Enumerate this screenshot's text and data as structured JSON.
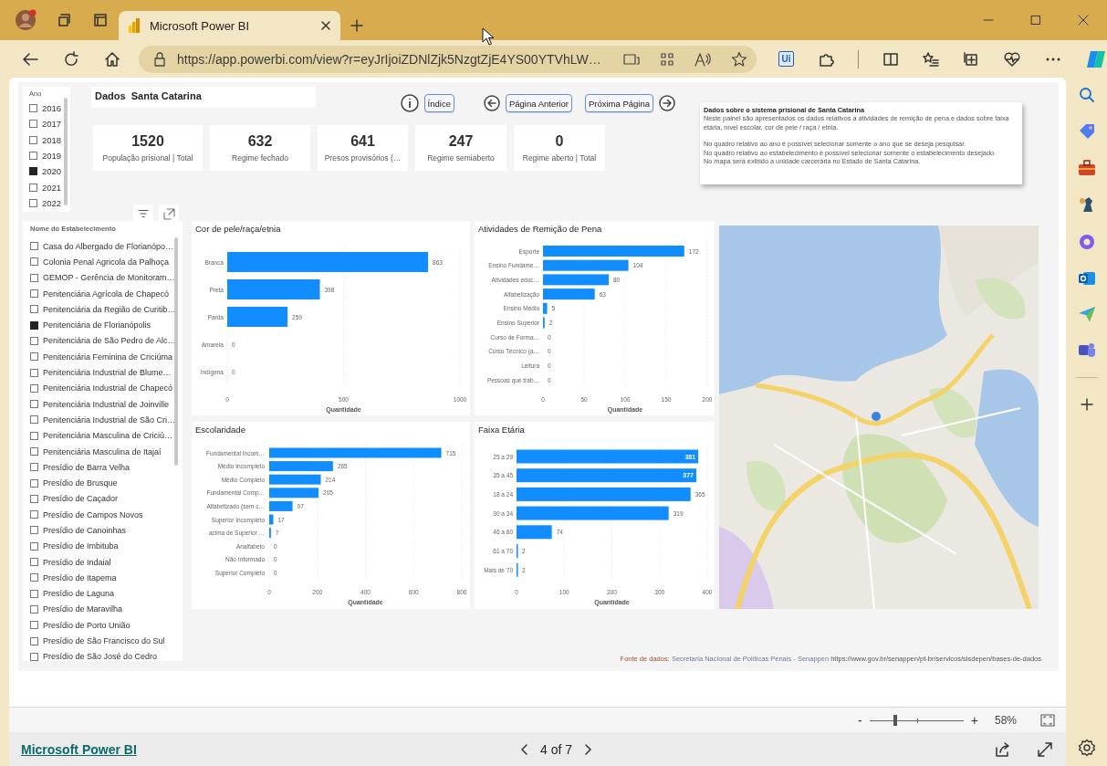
{
  "browser": {
    "tab_title": "Microsoft Power BI",
    "url": "https://app.powerbi.com/view?r=eyJrIjoiZDNlZjk5NzgtZjE4YS00YTVhLW…",
    "extension_label": "Ui"
  },
  "report": {
    "year_slicer": {
      "title": "Ano",
      "items": [
        {
          "label": "2016",
          "checked": false
        },
        {
          "label": "2017",
          "checked": false
        },
        {
          "label": "2018",
          "checked": false
        },
        {
          "label": "2019",
          "checked": false
        },
        {
          "label": "2020",
          "checked": true
        },
        {
          "label": "2021",
          "checked": false
        },
        {
          "label": "2022",
          "checked": false
        }
      ]
    },
    "title": "Dados  Santa Catarina",
    "kpis": [
      {
        "value": "1520",
        "label": "População prisional | Total"
      },
      {
        "value": "632",
        "label": "Regime fechado"
      },
      {
        "value": "641",
        "label": "Presos provisórios (…"
      },
      {
        "value": "247",
        "label": "Regime semiaberto"
      },
      {
        "value": "0",
        "label": "Regime aberto | Total"
      }
    ],
    "nav": {
      "index_button": "Índice",
      "prev_button": "Página Anterior",
      "next_button": "Próxima Página"
    },
    "info_box": {
      "title": "Dados sobre o sistema prisional de Santa Catarina",
      "sections": [
        [
          "Neste painel são apresentados os dados relativos a atividades de remição de pena e dados sobre faixa etária, nível escolar, cor de pele / raça / etnia."
        ],
        [
          "No quadro relativo ao ano é possível selecionar somente o ano que se deseja pesquisar.",
          "No quadro relativo ao estabelecimento é possível selecionar somente o estabelecimento desejado.",
          "No mapa será exibido a unidade carcerária no Estado de Santa Catarina."
        ]
      ]
    },
    "establishment_slicer": {
      "title": "Nome do Estabelecimento",
      "items": [
        {
          "label": "Casa do Albergado de Florianópo…",
          "checked": false
        },
        {
          "label": "Colonia Penal Agricola da Palhoça",
          "checked": false
        },
        {
          "label": "GEMOP - Gerência de Monitoram…",
          "checked": false
        },
        {
          "label": "Penitenciária Agrícola de Chapecó",
          "checked": false
        },
        {
          "label": "Penitenciária da Região de Curitib…",
          "checked": false
        },
        {
          "label": "Penitenciária de Florianópolis",
          "checked": true
        },
        {
          "label": "Penitenciária de São Pedro de Alc…",
          "checked": false
        },
        {
          "label": "Penitenciária Feminina de Criciúma",
          "checked": false
        },
        {
          "label": "Penitenciária Industrial de Blume…",
          "checked": false
        },
        {
          "label": "Penitenciária Industrial de Chapecó",
          "checked": false
        },
        {
          "label": "Penitenciária Industrial de Joinville",
          "checked": false
        },
        {
          "label": "Penitenciária Industrial de São Cri…",
          "checked": false
        },
        {
          "label": "Penitenciária Masculina de Criciú…",
          "checked": false
        },
        {
          "label": "Penitenciária Masculina de Itajaí",
          "checked": false
        },
        {
          "label": "Presídio de Barra Velha",
          "checked": false
        },
        {
          "label": "Presídio de Brusque",
          "checked": false
        },
        {
          "label": "Presídio de Caçador",
          "checked": false
        },
        {
          "label": "Presídio de Campos Novos",
          "checked": false
        },
        {
          "label": "Presídio de Canoinhas",
          "checked": false
        },
        {
          "label": "Presídio de Imbituba",
          "checked": false
        },
        {
          "label": "Presídio de Indaial",
          "checked": false
        },
        {
          "label": "Presídio de Itapema",
          "checked": false
        },
        {
          "label": "Presídio de Laguna",
          "checked": false
        },
        {
          "label": "Presídio de Maravilha",
          "checked": false
        },
        {
          "label": "Presídio de Porto União",
          "checked": false
        },
        {
          "label": "Presídio de São Francisco do Sul",
          "checked": false
        },
        {
          "label": "Presídio de São José do Cedro",
          "checked": false
        }
      ]
    },
    "charts": [
      {
        "chart_data": {
          "type": "bar",
          "orientation": "horizontal",
          "title": "Cor de pele/raça/etnia",
          "xlabel": "Quantidade",
          "categories": [
            "Branca",
            "Preta",
            "Parda",
            "Amarela",
            "Indígena"
          ],
          "series": [
            {
              "color": "#118dff",
              "values": [
                863,
                398,
                259,
                0,
                0
              ]
            }
          ],
          "grid": true,
          "xlim": [
            0,
            1000
          ],
          "xticks": [
            0,
            500,
            1000
          ],
          "data_labels": true
        }
      },
      {
        "chart_data": {
          "type": "bar",
          "orientation": "horizontal",
          "title": "Atividades de Remição de Pena",
          "xlabel": "Quantidade",
          "categories": [
            "Esporte",
            "Ensino Fundame…",
            "Atividades educ…",
            "Alfabetização",
            "Ensino Médio",
            "Ensino Superior",
            "Curso de Forma…",
            "Curso Técnico (a…",
            "Leitura",
            "Pessoas que trab…"
          ],
          "series": [
            {
              "color": "#118dff",
              "values": [
                172,
                104,
                80,
                63,
                5,
                2,
                0,
                0,
                0,
                0
              ]
            }
          ],
          "grid": true,
          "xlim": [
            0,
            200
          ],
          "xticks": [
            0,
            50,
            100,
            150,
            200
          ],
          "data_labels": true
        }
      },
      {
        "chart_data": {
          "type": "bar",
          "orientation": "horizontal",
          "title": "Escolaridade",
          "xlabel": "Quantidade",
          "categories": [
            "Fundamental Incom…",
            "Médio Incompleto",
            "Médio Completo",
            "Fundamental Comp…",
            "Alfabetizado (sem c…",
            "Superior Incompleto",
            "acima de Superior …",
            "Analfabeto",
            "Não Informado",
            "Superior Completo"
          ],
          "series": [
            {
              "color": "#118dff",
              "values": [
                715,
                265,
                214,
                205,
                97,
                17,
                7,
                0,
                0,
                0
              ]
            }
          ],
          "grid": true,
          "xlim": [
            0,
            800
          ],
          "xticks": [
            0,
            200,
            400,
            600,
            800
          ],
          "data_labels": true
        }
      },
      {
        "chart_data": {
          "type": "bar",
          "orientation": "horizontal",
          "title": "Faixa Etária",
          "xlabel": "Quantidade",
          "categories": [
            "25 a 29",
            "35 a 45",
            "18 a 24",
            "30 a 34",
            "46 a 60",
            "61 a 70",
            "Mais de 70"
          ],
          "series": [
            {
              "color": "#118dff",
              "values": [
                381,
                377,
                365,
                319,
                74,
                2,
                2
              ]
            }
          ],
          "grid": true,
          "xlim": [
            0,
            400
          ],
          "xticks": [
            0,
            100,
            200,
            300,
            400
          ],
          "data_labels": true
        }
      }
    ],
    "source": {
      "label": "Fonte de dados:",
      "text": "Secretaria Nacional de Políticas Penais - Senappen",
      "url": "https://www.gov.br/senappen/pt-br/servicos/sisdepen/bases-de-dados"
    }
  },
  "zoom": {
    "minus": "-",
    "plus": "+",
    "reading": "58%",
    "level": 0.27
  },
  "footer": {
    "brand_link": "Microsoft Power BI",
    "pager": "4 of 7"
  }
}
